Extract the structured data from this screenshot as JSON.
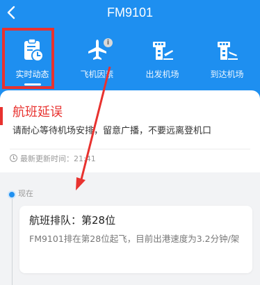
{
  "header": {
    "back_icon": "chevron-left-icon",
    "title": "FM9101",
    "background": "#1e8ff0"
  },
  "tabs": [
    {
      "label": "实时动态",
      "icon": "clipboard-clock-icon",
      "active": true
    },
    {
      "label": "飞机因素",
      "icon": "airplane-icon",
      "badge": "i"
    },
    {
      "label": "出发机场",
      "icon": "control-tower-departure-icon"
    },
    {
      "label": "到达机场",
      "icon": "control-tower-arrival-icon"
    }
  ],
  "status_card": {
    "status": "航班延误",
    "notice": "请耐心等待机场安排，留意广播，不要远离登机口",
    "update_label": "最新更新时间：",
    "update_time": "21:41",
    "status_color": "#e8322f"
  },
  "timeline": {
    "now_label": "现在",
    "item": {
      "title": "航班排队：第28位",
      "desc": "FM9101排在第28位起飞，目前出港速度为3.2分钟/架"
    }
  },
  "annotation": {
    "highlight_color": "#e8322f"
  }
}
